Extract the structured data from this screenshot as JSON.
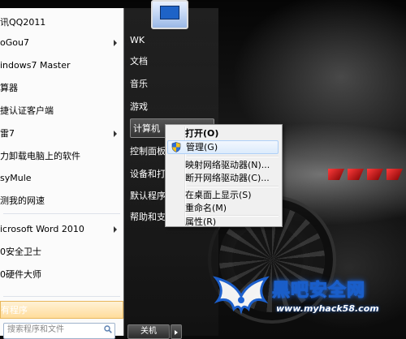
{
  "start_menu": {
    "programs": [
      {
        "label": "讯QQ2011",
        "has_arrow": false
      },
      {
        "label": "oGou7",
        "has_arrow": true
      },
      {
        "label": "indows7 Master",
        "has_arrow": false
      },
      {
        "label": "算器",
        "has_arrow": false
      },
      {
        "label": "捷认证客户端",
        "has_arrow": false
      },
      {
        "label": "雷7",
        "has_arrow": true
      },
      {
        "label": "力卸载电脑上的软件",
        "has_arrow": false
      },
      {
        "label": "syMule",
        "has_arrow": false
      },
      {
        "label": "测我的网速",
        "has_arrow": false
      },
      {
        "label": "icrosoft Word 2010",
        "has_arrow": true
      },
      {
        "label": "0安全卫士",
        "has_arrow": false
      },
      {
        "label": "0硬件大师",
        "has_arrow": false
      }
    ],
    "all_programs_label": "有程序",
    "search_placeholder": "搜索程序和文件",
    "right_items": [
      {
        "label": "WK"
      },
      {
        "label": "文档"
      },
      {
        "label": "音乐"
      },
      {
        "label": "游戏"
      },
      {
        "label": "计算机"
      },
      {
        "label": "控制面板"
      },
      {
        "label": "设备和打印"
      },
      {
        "label": "默认程序"
      },
      {
        "label": "帮助和支持"
      }
    ],
    "shutdown_label": "关机"
  },
  "context_menu": {
    "items": [
      {
        "label": "打开(O)"
      },
      {
        "label": "管理(G)"
      },
      {
        "label": "映射网络驱动器(N)..."
      },
      {
        "label": "断开网络驱动器(C)..."
      },
      {
        "label": "在桌面上显示(S)"
      },
      {
        "label": "重命名(M)"
      },
      {
        "label": "属性(R)"
      }
    ]
  },
  "watermark": {
    "title": "黑吧安全网",
    "url": "www.myhack58.com"
  },
  "colors": {
    "menu_left_bg": "#fbfbfb",
    "menu_right_bg": "#2a2a2a",
    "hover_highlight": "#dcebfc",
    "all_programs_highlight": "#ffdc9a",
    "watermark_blue": "#1d64d6"
  }
}
